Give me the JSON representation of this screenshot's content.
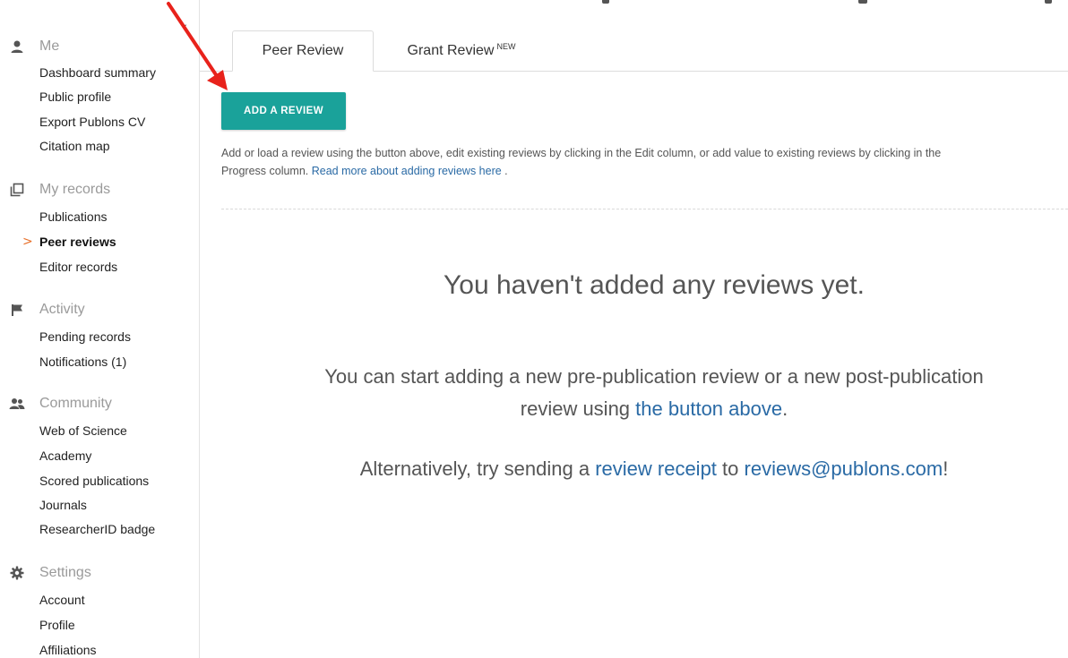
{
  "sidebar": {
    "collapse_glyph": "‹",
    "sections": [
      {
        "icon": "person-icon",
        "label": "Me",
        "items": [
          "Dashboard summary",
          "Public profile",
          "Export Publons CV",
          "Citation map"
        ]
      },
      {
        "icon": "copy-records-icon",
        "label": "My records",
        "items": [
          "Publications",
          "Peer reviews",
          "Editor records"
        ]
      },
      {
        "icon": "flag-icon",
        "label": "Activity",
        "items": [
          "Pending records",
          "Notifications (1)"
        ]
      },
      {
        "icon": "people-icon",
        "label": "Community",
        "items": [
          "Web of Science",
          "Academy",
          "Scored publications",
          "Journals",
          "ResearcherID badge"
        ]
      },
      {
        "icon": "gear-icon",
        "label": "Settings",
        "items": [
          "Account",
          "Profile",
          "Affiliations"
        ]
      }
    ],
    "active_item": "Peer reviews",
    "active_marker": ">"
  },
  "tabs": {
    "peer_review": "Peer Review",
    "grant_review": "Grant Review",
    "grant_badge": "NEW"
  },
  "main": {
    "add_button": "ADD A REVIEW",
    "help_text": "Add or load a review using the button above, edit existing reviews by clicking in the Edit column, or add value to existing reviews by clicking in the Progress column.",
    "help_link": "Read more about adding reviews here",
    "help_end": ".",
    "empty_title": "You haven't added any reviews yet.",
    "empty_msg_start": "You can start adding a new pre-publication review or a new post-publication review using",
    "empty_msg_link": "the button above",
    "empty_msg_end": ".",
    "alt_start": "Alternatively, try sending a",
    "alt_link": "review receipt",
    "alt_middle": "to",
    "alt_email": "reviews@publons.com",
    "alt_end": "!"
  },
  "colors": {
    "accent": "#1aa29a",
    "link": "#2a6aa5",
    "active_marker": "#e8702a",
    "annotation_arrow": "#e8221b"
  }
}
